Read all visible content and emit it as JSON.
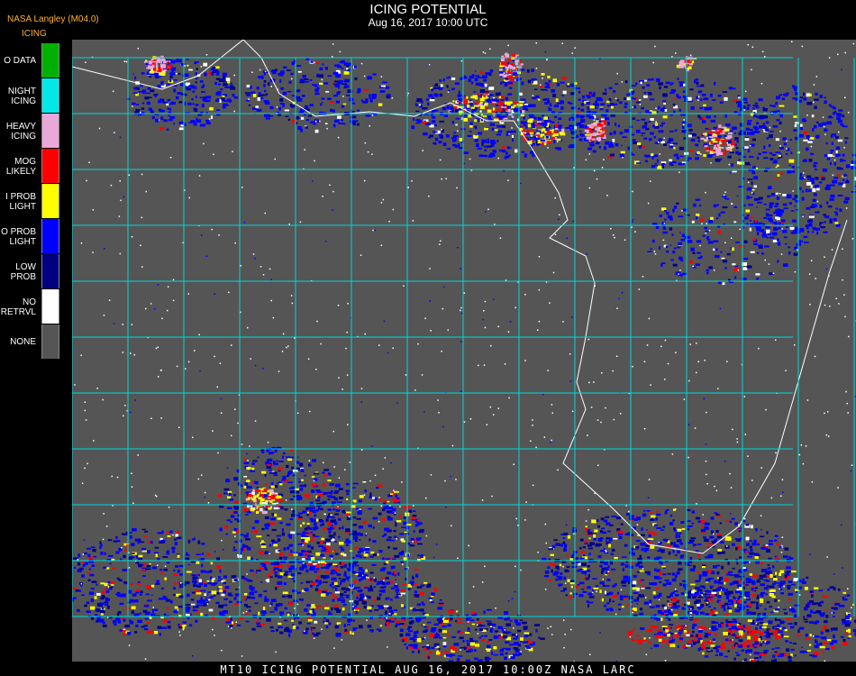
{
  "header": {
    "brand": "NASA Langley (M04.0)",
    "legend_title": "ICING",
    "title": "ICING POTENTIAL",
    "subtitle": "Aug 16, 2017 10:00 UTC"
  },
  "legend": [
    {
      "label_lines": [
        "O DATA"
      ],
      "color": "#00b000"
    },
    {
      "label_lines": [
        "NIGHT",
        "ICING"
      ],
      "color": "#00e8e8"
    },
    {
      "label_lines": [
        "HEAVY",
        "ICING"
      ],
      "color": "#e8a8d8"
    },
    {
      "label_lines": [
        "MOG",
        "LIKELY"
      ],
      "color": "#ff0000"
    },
    {
      "label_lines": [
        "I PROB",
        "LIGHT"
      ],
      "color": "#ffff00"
    },
    {
      "label_lines": [
        "O PROB",
        "LIGHT"
      ],
      "color": "#0000ff"
    },
    {
      "label_lines": [
        "LOW",
        "PROB"
      ],
      "color": "#000080"
    },
    {
      "label_lines": [
        "NO",
        "RETRVL"
      ],
      "color": "#ffffff"
    },
    {
      "label_lines": [
        "NONE"
      ],
      "color": "#555555"
    }
  ],
  "map": {
    "background": "#555555",
    "grid_color": "#00d8d8",
    "label_color": "#cc2020"
  },
  "footer": {
    "text": "MT10  ICING POTENTIAL   AUG 16, 2017 10:00Z   NASA LARC"
  }
}
